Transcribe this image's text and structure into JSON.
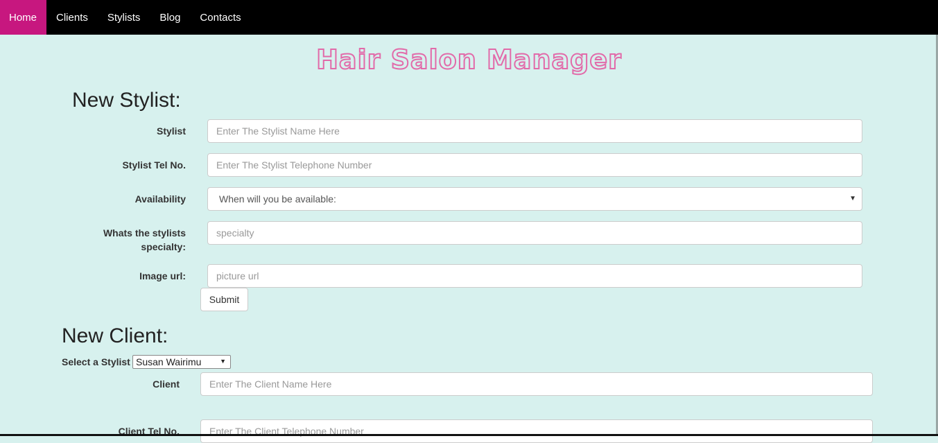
{
  "nav": {
    "items": [
      {
        "label": "Home"
      },
      {
        "label": "Clients"
      },
      {
        "label": "Stylists"
      },
      {
        "label": "Blog"
      },
      {
        "label": "Contacts"
      }
    ]
  },
  "logo": {
    "text": "Hair Salon Manager"
  },
  "stylist_form": {
    "heading": "New Stylist:",
    "stylist_label": "Stylist",
    "stylist_placeholder": "Enter The Stylist Name Here",
    "tel_label": "Stylist Tel No.",
    "tel_placeholder": "Enter The Stylist Telephone Number",
    "availability_label": "Availability",
    "availability_value": "When will you be available:",
    "specialty_label_1": "Whats the stylists",
    "specialty_label_2": "specialty:",
    "specialty_placeholder": "specialty",
    "image_label": "Image url:",
    "image_placeholder": "picture url",
    "submit_label": "Submit"
  },
  "client_form": {
    "heading": "New Client:",
    "select_stylist_label": "Select a Stylist",
    "select_stylist_value": "Susan Wairimu",
    "client_label": "Client",
    "client_placeholder": "Enter The Client Name Here",
    "tel_label": "Client Tel No.",
    "tel_placeholder": "Enter The Client Telephone Number"
  },
  "colors": {
    "background": "#d7f1ee",
    "nav_active": "#c7177f",
    "logo": "#e26aa9"
  }
}
